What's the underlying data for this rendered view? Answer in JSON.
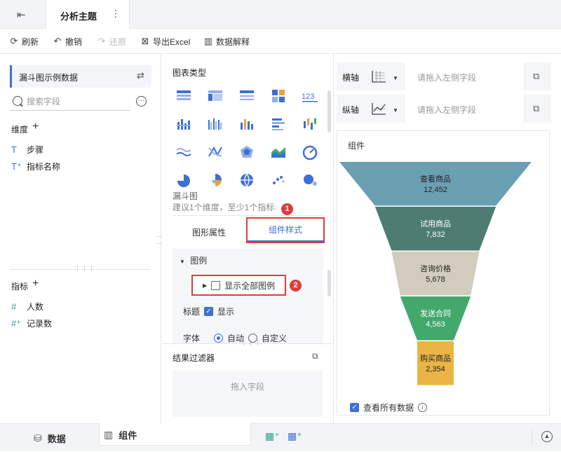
{
  "topbar": {
    "tab_title": "分析主题",
    "more": "⋮"
  },
  "toolbar": {
    "refresh": "刷新",
    "undo": "撤销",
    "redo": "还原",
    "export": "导出Excel",
    "explain": "数据解释"
  },
  "left": {
    "dataset": "漏斗图示例数据",
    "search_placeholder": "搜索字段",
    "dimension_title": "维度",
    "dimensions": [
      "步骤",
      "指标名称"
    ],
    "measure_title": "指标",
    "measures": [
      "人数",
      "记录数"
    ]
  },
  "middle": {
    "chart_type_label": "图表类型",
    "funnel_name": "漏斗图",
    "funnel_hint": "建议1个维度，至少1个指标",
    "tab_prop": "图形属性",
    "tab_style": "组件样式",
    "badge1": "1",
    "badge2": "2",
    "legend_section": "图例",
    "show_all_legend": "显示全部图例",
    "title_label": "标题",
    "title_show": "显示",
    "font_label": "字体",
    "font_auto": "自动",
    "font_custom": "自定义",
    "filter_title": "结果过滤器",
    "filter_drop": "拖入字段"
  },
  "right": {
    "x_axis": "横轴",
    "y_axis": "纵轴",
    "drop_placeholder": "请拖入左侧字段",
    "chart_title": "组件",
    "show_all_data": "查看所有数据"
  },
  "chart_data": {
    "type": "funnel",
    "categories": [
      "查看商品",
      "试用商品",
      "咨询价格",
      "发送合同",
      "购买商品"
    ],
    "values": [
      12452,
      7832,
      5678,
      4563,
      2354
    ],
    "value_labels": [
      "12,452",
      "7,832",
      "5,678",
      "4,563",
      "2,354"
    ],
    "colors": [
      "#6a9fb2",
      "#4e7c73",
      "#d1ccbd",
      "#43a86b",
      "#eab545"
    ],
    "label_colors": [
      "#222222",
      "#ffffff",
      "#222222",
      "#ffffff",
      "#222222"
    ]
  },
  "bottombar": {
    "data_tab": "数据",
    "component_tab": "组件"
  }
}
